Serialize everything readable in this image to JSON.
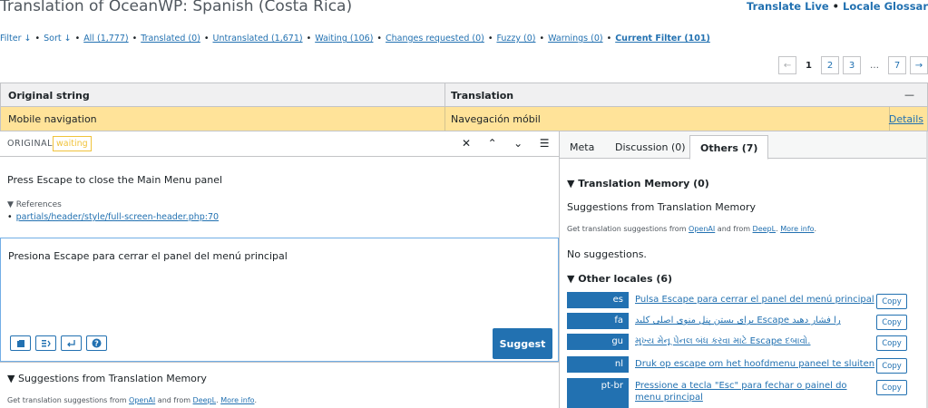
{
  "header": {
    "title": "Translation of OceanWP: Spanish (Costa Rica)",
    "translate_live": "Translate Live",
    "dot": "•",
    "locale_glossary": "Locale Glossar"
  },
  "filters": {
    "filter": "Filter ↓",
    "sort": "Sort ↓",
    "all": "All (1,777)",
    "translated": "Translated (0)",
    "untranslated": "Untranslated (1,671)",
    "waiting": "Waiting (106)",
    "changes_requested": "Changes requested (0)",
    "fuzzy": "Fuzzy (0)",
    "warnings": "Warnings (0)",
    "current_filter": "Current Filter (101)"
  },
  "pagination": {
    "prev": "←",
    "current": "1",
    "p2": "2",
    "p3": "3",
    "ellipsis": "…",
    "p7": "7",
    "next": "→"
  },
  "table": {
    "col_original": "Original string",
    "col_translation": "Translation",
    "col_actions": "—",
    "row_original": "Mobile navigation",
    "row_translation": "Navegación móbil",
    "row_details": "Details"
  },
  "editor": {
    "original_label": "ORIGINAL",
    "status_badge": "waiting",
    "tool_close": "✕",
    "tool_up": "⌃",
    "tool_down": "⌄",
    "tool_menu": "☰",
    "original_text": "Press Escape to close the Main Menu panel",
    "references_label": "▼ References",
    "reference_link": "partials/header/style/full-screen-header.php:70",
    "translation_text": "Presiona Escape para cerrar el panel del menú principal",
    "suggest_label": "Suggest",
    "tm_heading": "▼ Suggestions from Translation Memory",
    "tm_sub_prefix": "Get translation suggestions from ",
    "tm_sub_openai": "OpenAI",
    "tm_sub_mid": " and from ",
    "tm_sub_deepl": "DeepL",
    "tm_sub_dot": ". ",
    "tm_sub_more": "More info",
    "tm_sub_end": "."
  },
  "sidebar": {
    "tab_meta": "Meta",
    "tab_discussion": "Discussion (0)",
    "tab_others": "Others (7)",
    "tm_heading": "▼ Translation Memory (0)",
    "tm_suggestions": "Suggestions from Translation Memory",
    "tm_sub_prefix": "Get translation suggestions from ",
    "tm_sub_openai": "OpenAI",
    "tm_sub_mid": " and from ",
    "tm_sub_deepl": "DeepL",
    "tm_sub_dot": ". ",
    "tm_sub_more": "More info",
    "tm_sub_end": ".",
    "no_suggestions": "No suggestions.",
    "other_locales_heading": "▼ Other locales (6)",
    "copy_label": "Copy",
    "locales": [
      {
        "code": "es",
        "text": "Pulsa Escape para cerrar el panel del menú principal"
      },
      {
        "code": "fa",
        "text": "را فشار دهید Escape برای بستن پنل منوی اصلی کلید"
      },
      {
        "code": "gu",
        "text": "મુખ્ય મેનૂ પેનલ બંધ કરવા માટે Escape દબાવો."
      },
      {
        "code": "nl",
        "text": "Druk op escape om het hoofdmenu paneel te sluiten"
      },
      {
        "code": "pt-br",
        "text": "Pressione a tecla \"Esc\" para fechar o painel do menu principal"
      }
    ]
  },
  "colors": {
    "accent": "#2271b1",
    "row_highlight": "#ffe399",
    "waiting_badge": "#f0c33c"
  }
}
